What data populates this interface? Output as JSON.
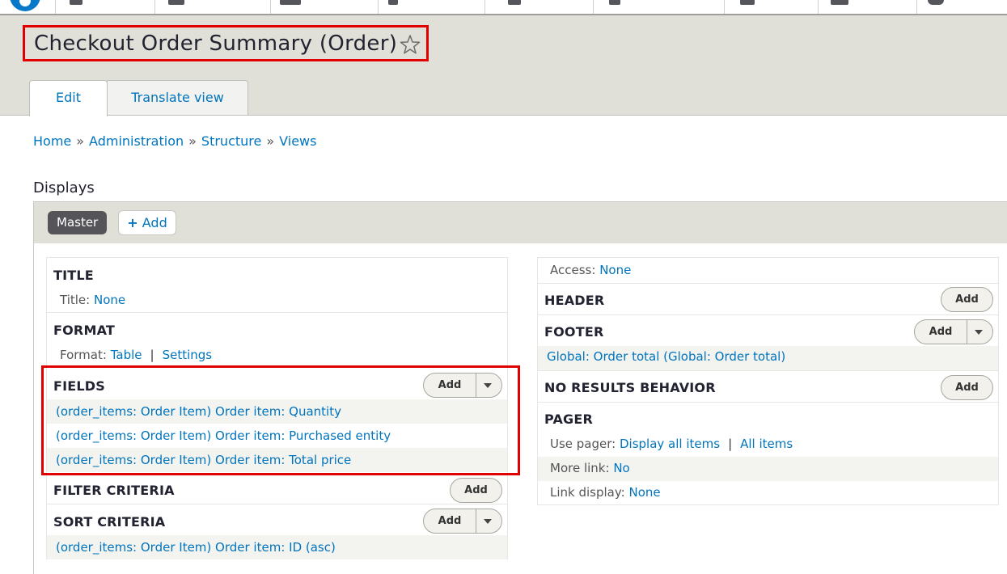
{
  "page": {
    "title": "Checkout Order Summary (Order)",
    "tabs": [
      "Edit",
      "Translate view"
    ],
    "breadcrumb": [
      "Home",
      "Administration",
      "Structure",
      "Views"
    ],
    "breadcrumb_separator": "»"
  },
  "displays": {
    "heading": "Displays",
    "active": "Master",
    "add_label": "Add",
    "add_icon": "+"
  },
  "left": {
    "title_section": {
      "heading": "TITLE",
      "label": "Title:",
      "value": "None"
    },
    "format_section": {
      "heading": "FORMAT",
      "label": "Format:",
      "value": "Table",
      "settings": "Settings",
      "separator": "|"
    },
    "fields_section": {
      "heading": "FIELDS",
      "add_label": "Add",
      "items": [
        "(order_items: Order Item) Order item: Quantity",
        "(order_items: Order Item) Order item: Purchased entity",
        "(order_items: Order Item) Order item: Total price"
      ]
    },
    "filter_section": {
      "heading": "FILTER CRITERIA",
      "add_label": "Add"
    },
    "sort_section": {
      "heading": "SORT CRITERIA",
      "add_label": "Add",
      "items": [
        "(order_items: Order Item) Order item: ID (asc)"
      ]
    }
  },
  "right": {
    "access": {
      "label": "Access:",
      "value": "None"
    },
    "header_section": {
      "heading": "HEADER",
      "add_label": "Add"
    },
    "footer_section": {
      "heading": "FOOTER",
      "add_label": "Add",
      "items": [
        "Global: Order total (Global: Order total)"
      ]
    },
    "no_results_section": {
      "heading": "NO RESULTS BEHAVIOR",
      "add_label": "Add"
    },
    "pager_section": {
      "heading": "PAGER",
      "use_pager": {
        "label": "Use pager:",
        "value": "Display all items",
        "separator": "|",
        "value2": "All items"
      },
      "more_link": {
        "label": "More link:",
        "value": "No"
      },
      "link_display": {
        "label": "Link display:",
        "value": "None"
      }
    }
  },
  "colors": {
    "link": "#0074bd",
    "highlight": "#e00000",
    "master_pill": "#555559",
    "header_bg": "#e0e0d8"
  },
  "icons": [
    "drupal-logo-icon",
    "star-outline-icon",
    "plus-icon",
    "caret-down-icon"
  ]
}
